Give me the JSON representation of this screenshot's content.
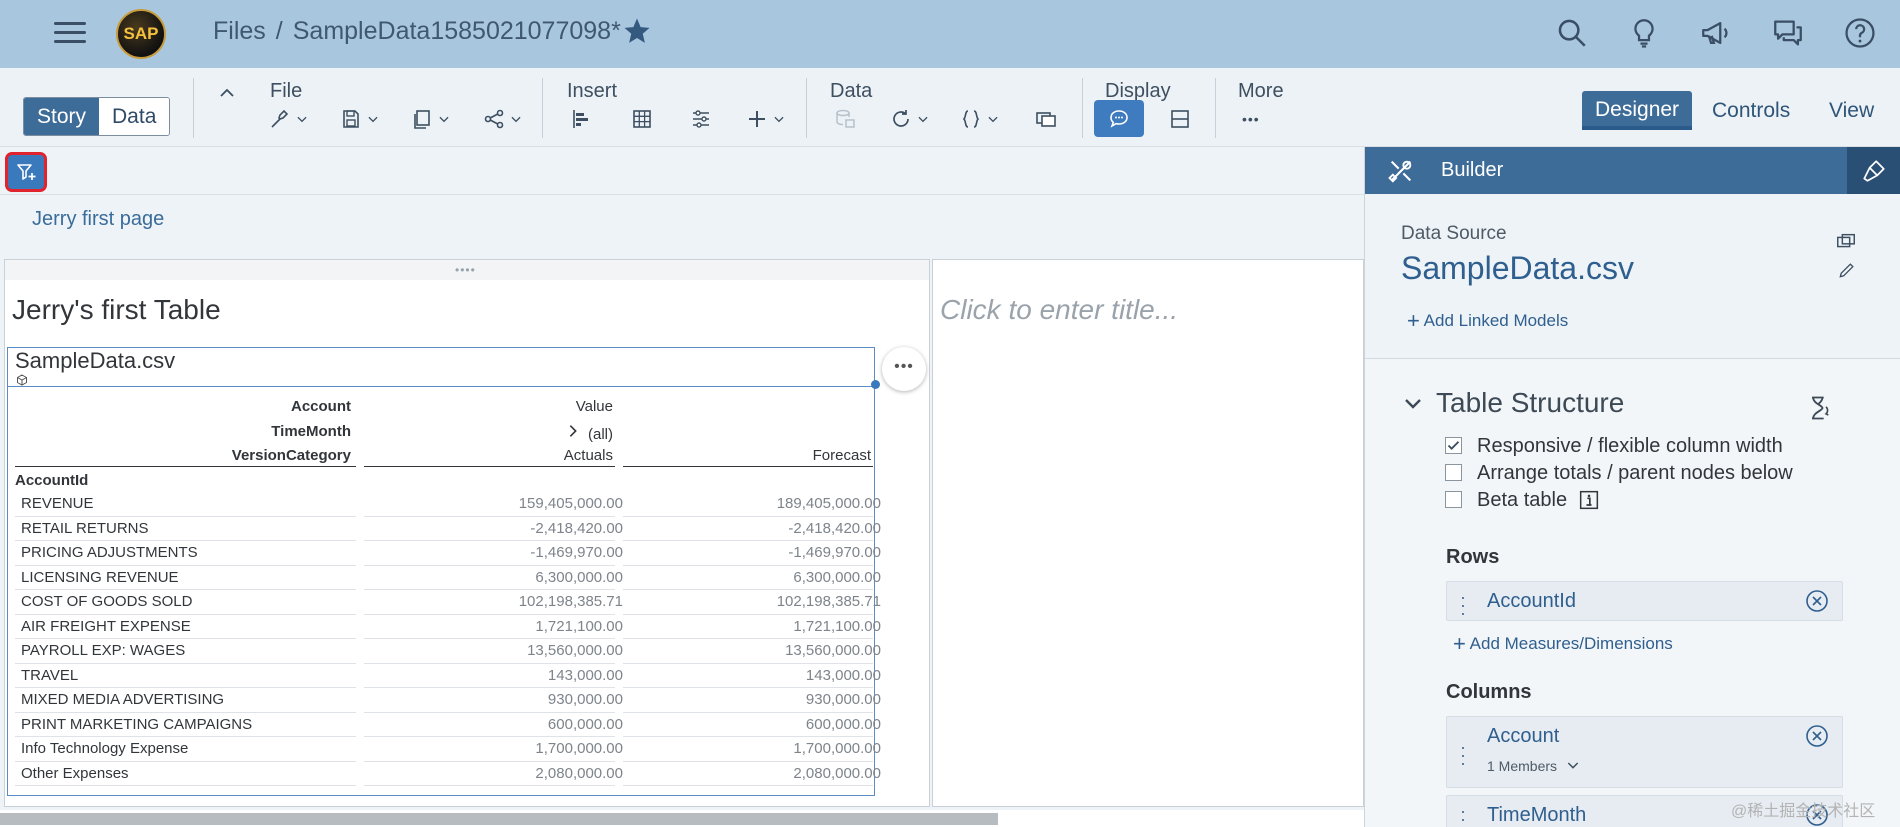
{
  "shell": {
    "logo_text": "SAP",
    "breadcrumb_root": "Files",
    "breadcrumb_separator": "/",
    "breadcrumb_current": "SampleData1585021077098*"
  },
  "toolbar": {
    "mode_story": "Story",
    "mode_data": "Data",
    "group_file": "File",
    "group_insert": "Insert",
    "group_data": "Data",
    "group_display": "Display",
    "group_more": "More",
    "more_dots": "•••"
  },
  "right_tabs": {
    "designer": "Designer",
    "controls": "Controls",
    "view": "View"
  },
  "page": {
    "tab_label": "Jerry first page"
  },
  "left_tile": {
    "title": "Jerry's first Table",
    "table_name": "SampleData.csv",
    "ctx_dots": "•••",
    "headers": {
      "account": "Account",
      "value": "Value",
      "timemonth": "TimeMonth",
      "all": "(all)",
      "versioncategory": "VersionCategory",
      "actuals": "Actuals",
      "forecast": "Forecast",
      "accountid": "AccountId"
    },
    "rows": [
      {
        "name": "REVENUE",
        "actuals": "159,405,000.00",
        "forecast": "189,405,000.00"
      },
      {
        "name": "RETAIL RETURNS",
        "actuals": "-2,418,420.00",
        "forecast": "-2,418,420.00"
      },
      {
        "name": "PRICING ADJUSTMENTS",
        "actuals": "-1,469,970.00",
        "forecast": "-1,469,970.00"
      },
      {
        "name": "LICENSING REVENUE",
        "actuals": "6,300,000.00",
        "forecast": "6,300,000.00"
      },
      {
        "name": "COST OF GOODS SOLD",
        "actuals": "102,198,385.71",
        "forecast": "102,198,385.71"
      },
      {
        "name": "AIR FREIGHT EXPENSE",
        "actuals": "1,721,100.00",
        "forecast": "1,721,100.00"
      },
      {
        "name": "PAYROLL EXP: WAGES",
        "actuals": "13,560,000.00",
        "forecast": "13,560,000.00"
      },
      {
        "name": "TRAVEL",
        "actuals": "143,000.00",
        "forecast": "143,000.00"
      },
      {
        "name": "MIXED MEDIA ADVERTISING",
        "actuals": "930,000.00",
        "forecast": "930,000.00"
      },
      {
        "name": "PRINT MARKETING CAMPAIGNS",
        "actuals": "600,000.00",
        "forecast": "600,000.00"
      },
      {
        "name": "Info Technology Expense",
        "actuals": "1,700,000.00",
        "forecast": "1,700,000.00"
      },
      {
        "name": "Other Expenses",
        "actuals": "2,080,000.00",
        "forecast": "2,080,000.00"
      }
    ]
  },
  "right_tile": {
    "title_placeholder": "Click to enter title..."
  },
  "builder": {
    "title": "Builder",
    "data_source_label": "Data Source",
    "data_source_name": "SampleData.csv",
    "add_linked_models": "Add Linked Models",
    "table_structure": "Table Structure",
    "options": [
      {
        "label": "Responsive / flexible column width",
        "checked": true
      },
      {
        "label": "Arrange totals / parent nodes below",
        "checked": false
      },
      {
        "label": "Beta table",
        "checked": false
      }
    ],
    "rows_label": "Rows",
    "rows_item": "AccountId",
    "add_measures": "Add Measures/Dimensions",
    "columns_label": "Columns",
    "columns": [
      {
        "name": "Account",
        "sub": "1 Members"
      },
      {
        "name": "TimeMonth"
      }
    ]
  },
  "watermark": "@稀土掘金技术社区",
  "colors": {
    "shell": "#a9c6df",
    "accent": "#3e6c98",
    "highlight": "#e0232d"
  }
}
